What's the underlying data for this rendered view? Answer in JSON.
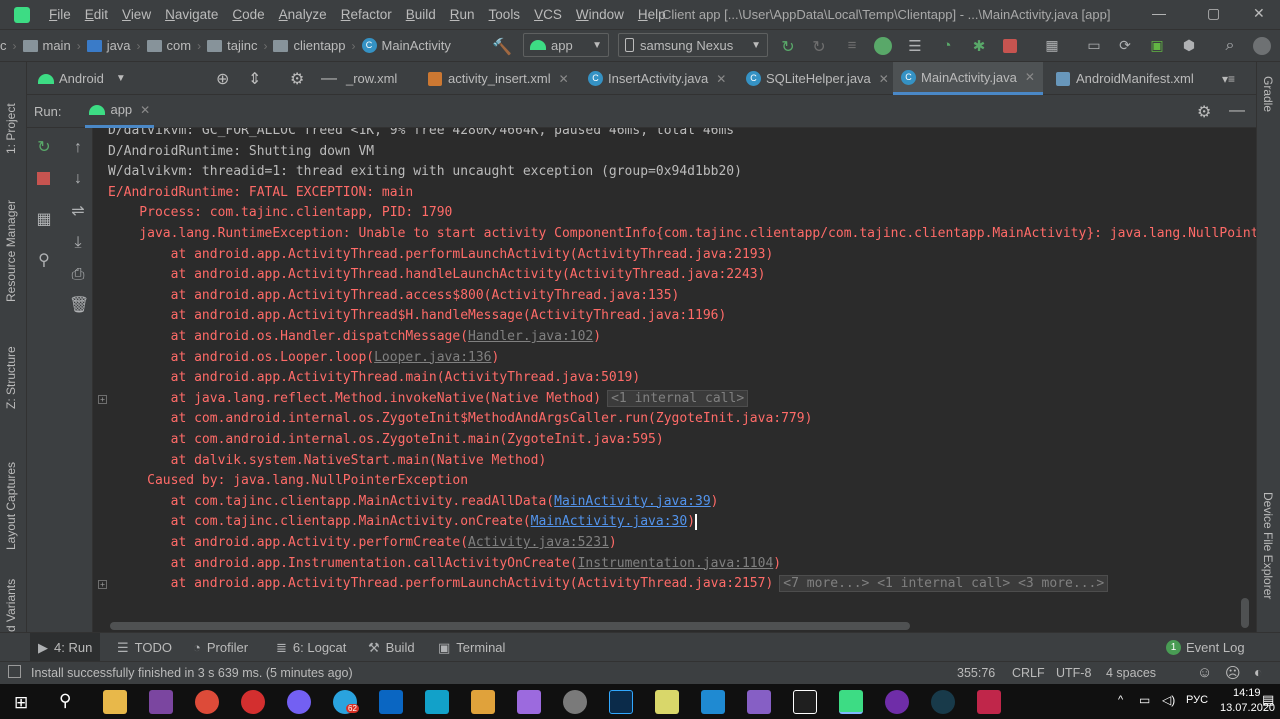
{
  "window": {
    "title": "Client app [...\\User\\AppData\\Local\\Temp\\Clientapp] - ...\\MainActivity.java [app]",
    "controls": [
      "—",
      "▢",
      "✕"
    ]
  },
  "menu": [
    "File",
    "Edit",
    "View",
    "Navigate",
    "Code",
    "Analyze",
    "Refactor",
    "Build",
    "Run",
    "Tools",
    "VCS",
    "Window",
    "Help"
  ],
  "breadcrumbs": [
    "c",
    "main",
    "java",
    "com",
    "tajinc",
    "clientapp",
    "MainActivity"
  ],
  "toolbar": {
    "config": "app",
    "device": "samsung Nexus"
  },
  "project_view": {
    "selector": "Android"
  },
  "editor_tabs": [
    {
      "label": "_row.xml",
      "type": "xml",
      "active": false
    },
    {
      "label": "activity_insert.xml",
      "type": "xml",
      "active": false
    },
    {
      "label": "InsertActivity.java",
      "type": "class",
      "active": false
    },
    {
      "label": "SQLiteHelper.java",
      "type": "class",
      "active": false
    },
    {
      "label": "MainActivity.java",
      "type": "class",
      "active": true
    },
    {
      "label": "AndroidManifest.xml",
      "type": "manifest",
      "active": false
    }
  ],
  "left_stripe": [
    "1: Project",
    "Resource Manager",
    "Z: Structure",
    "Layout Captures",
    "d Variants"
  ],
  "right_stripe": [
    "Gradle",
    "Device File Explorer"
  ],
  "run_panel": {
    "label": "Run:",
    "tab": "app"
  },
  "console": {
    "lines": [
      {
        "color": "white",
        "text": "D/dalvikvm: GC_FOR_ALLOC freed <1K, 9% free 4280K/4664K, paused 46ms, total 46ms"
      },
      {
        "color": "white",
        "text": "D/AndroidRuntime: Shutting down VM"
      },
      {
        "color": "white",
        "text": "W/dalvikvm: threadid=1: thread exiting with uncaught exception (group=0x94d1bb20)"
      },
      {
        "color": "red",
        "text": "E/AndroidRuntime: FATAL EXCEPTION: main"
      },
      {
        "color": "red",
        "text": "    Process: com.tajinc.clientapp, PID: 1790"
      },
      {
        "color": "red",
        "text": "    java.lang.RuntimeException: Unable to start activity ComponentInfo{com.tajinc.clientapp/com.tajinc.clientapp.MainActivity}: java.lang.NullPointerExce"
      },
      {
        "color": "red",
        "text": "        at android.app.ActivityThread.performLaunchActivity(ActivityThread.java:2193)"
      },
      {
        "color": "red",
        "text": "        at android.app.ActivityThread.handleLaunchActivity(ActivityThread.java:2243)"
      },
      {
        "color": "red",
        "text": "        at android.app.ActivityThread.access$800(ActivityThread.java:135)"
      },
      {
        "color": "red",
        "text": "        at android.app.ActivityThread$H.handleMessage(ActivityThread.java:1196)"
      },
      {
        "color": "red",
        "text": "        at android.os.Handler.dispatchMessage(",
        "link": "Handler.java:102",
        "link_style": "grey",
        "after": ")"
      },
      {
        "color": "red",
        "text": "        at android.os.Looper.loop(",
        "link": "Looper.java:136",
        "link_style": "grey",
        "after": ")"
      },
      {
        "color": "red",
        "text": "        at android.app.ActivityThread.main(ActivityThread.java:5019)"
      },
      {
        "color": "red",
        "text": "        at java.lang.reflect.Method.invokeNative(Native Method)",
        "fold": "<1 internal call>",
        "plus": true
      },
      {
        "color": "red",
        "text": "        at com.android.internal.os.ZygoteInit$MethodAndArgsCaller.run(ZygoteInit.java:779)"
      },
      {
        "color": "red",
        "text": "        at com.android.internal.os.ZygoteInit.main(ZygoteInit.java:595)"
      },
      {
        "color": "red",
        "text": "        at dalvik.system.NativeStart.main(Native Method)"
      },
      {
        "color": "red",
        "text": "     Caused by: java.lang.NullPointerException"
      },
      {
        "color": "red",
        "text": "        at com.tajinc.clientapp.MainActivity.readAllData(",
        "link": "MainActivity.java:39",
        "link_style": "blue",
        "after": ")"
      },
      {
        "color": "red",
        "text": "        at com.tajinc.clientapp.MainActivity.onCreate(",
        "link": "MainActivity.java:30",
        "link_style": "blue",
        "after": ")",
        "cursor": true
      },
      {
        "color": "red",
        "text": "        at android.app.Activity.performCreate(",
        "link": "Activity.java:5231",
        "link_style": "grey",
        "after": ")"
      },
      {
        "color": "red",
        "text": "        at android.app.Instrumentation.callActivityOnCreate(",
        "link": "Instrumentation.java:1104",
        "link_style": "grey",
        "after": ")"
      },
      {
        "color": "red",
        "text": "        at android.app.ActivityThread.performLaunchActivity(ActivityThread.java:2157)",
        "fold": "<7 more...> <1 internal call> <3 more...>",
        "plus": true
      }
    ]
  },
  "tool_tabs": {
    "run": "4: Run",
    "todo": "TODO",
    "profiler": "Profiler",
    "logcat": "6: Logcat",
    "build": "Build",
    "terminal": "Terminal",
    "event_log_count": "1",
    "event_log": "Event Log"
  },
  "status": {
    "message": "Install successfully finished in 3 s 639 ms. (5 minutes ago)",
    "position": "355:76",
    "line_sep": "CRLF",
    "encoding": "UTF-8",
    "indent": "4 spaces"
  },
  "taskbar": {
    "language": "РУС",
    "time": "14:19",
    "date": "13.07.2020",
    "badge": "62"
  },
  "colors": {
    "accent": "#4a88c7",
    "error_red": "#ff6b68",
    "link_blue": "#5394ec",
    "android_green": "#3ddc84"
  }
}
